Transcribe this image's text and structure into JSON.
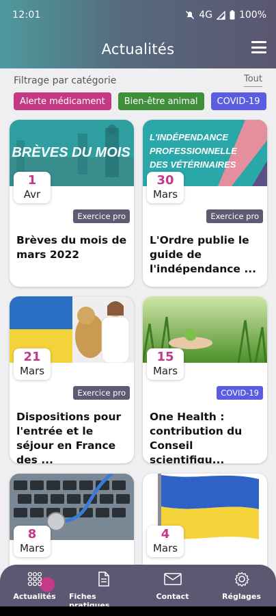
{
  "status_bar": {
    "time": "12:01",
    "network": "4G",
    "battery": "100%"
  },
  "app_bar": {
    "title": "Actualités"
  },
  "filter": {
    "label": "Filtrage par catégorie",
    "all_label": "Tout",
    "chips": [
      "Alerte médicament",
      "Bien-être animal",
      "COVID-19"
    ]
  },
  "cards": [
    {
      "image_text": "BRÈVES DU MOIS",
      "day": "1",
      "month": "Avr",
      "tag": "Exercice pro",
      "title": "Brèves du mois de mars 2022"
    },
    {
      "image_text": [
        "L'INDÉPENDANCE",
        "PROFESSIONNELLE",
        "DES VÉTÉRINAIRES"
      ],
      "day": "30",
      "month": "Mars",
      "tag": "Exercice pro",
      "title": "L'Ordre publie le guide de l'indépendance ..."
    },
    {
      "day": "21",
      "month": "Mars",
      "tag": "Exercice pro",
      "title": "Dispositions pour l'entrée et le séjour en France des ..."
    },
    {
      "day": "15",
      "month": "Mars",
      "tag": "COVID-19",
      "title": "One Health : contribution du Conseil scientifiqu..."
    },
    {
      "day": "8",
      "month": "Mars"
    },
    {
      "day": "4",
      "month": "Mars"
    }
  ],
  "bottom_nav": {
    "items": [
      {
        "label": "Actualités",
        "icon": "news-grid-icon"
      },
      {
        "label": "Fiches pratiques",
        "icon": "document-icon"
      },
      {
        "label": "Contact",
        "icon": "envelope-icon"
      },
      {
        "label": "Réglages",
        "icon": "gear-icon"
      }
    ],
    "active_index": 0
  },
  "colors": {
    "header_start": "#4e9a9e",
    "header_end": "#5b5670",
    "accent_magenta": "#c0398a",
    "chip_alerte": "#c53984",
    "chip_bien_etre": "#3e8e3a",
    "chip_covid": "#5a5de0",
    "tag_exercice_pro": "#5e5a72",
    "nav_background": "#5d5872"
  }
}
